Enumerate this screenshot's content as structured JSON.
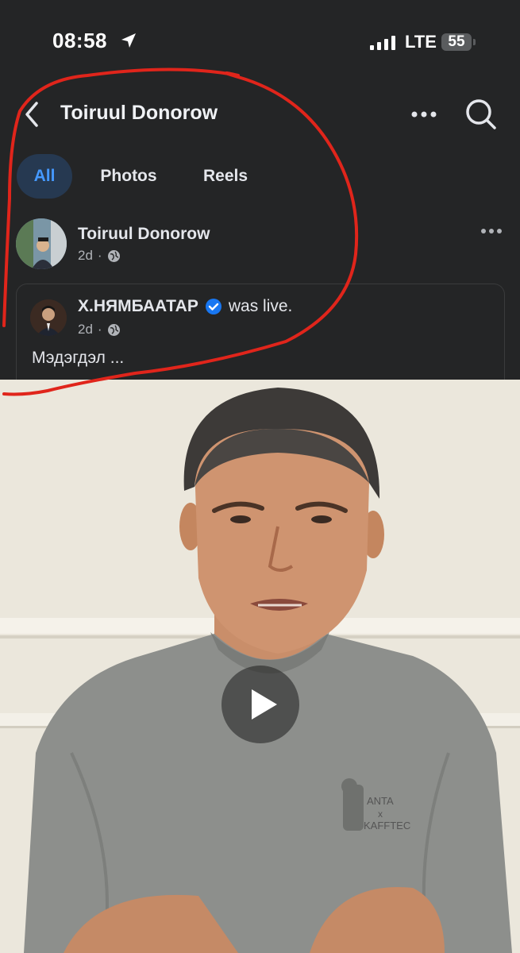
{
  "status_bar": {
    "time": "08:58",
    "network": "LTE",
    "battery": "55"
  },
  "header": {
    "title": "Toiruul Donorow"
  },
  "tabs": [
    {
      "label": "All",
      "active": true
    },
    {
      "label": "Photos",
      "active": false
    },
    {
      "label": "Reels",
      "active": false
    }
  ],
  "post": {
    "author": "Toiruul Donorow",
    "time": "2d",
    "separator": "·",
    "shared": {
      "author": "Х.НЯМБААТАР",
      "verified": true,
      "action": "was live.",
      "time": "2d",
      "separator": "·",
      "text": "Мэдэгдэл ..."
    }
  },
  "video": {
    "shirt_text_1": "ANTA",
    "shirt_text_2": "x",
    "shirt_text_3": "KAFFTEC"
  },
  "colors": {
    "background": "#242526",
    "accent": "#4599ff",
    "active_tab_bg": "#263951",
    "verified": "#1877f2",
    "annotation": "#e0251b"
  },
  "icons": [
    "location-arrow-icon",
    "signal-icon",
    "battery-icon",
    "back-arrow-icon",
    "more-icon",
    "search-icon",
    "globe-icon",
    "verified-badge-icon",
    "play-icon"
  ]
}
